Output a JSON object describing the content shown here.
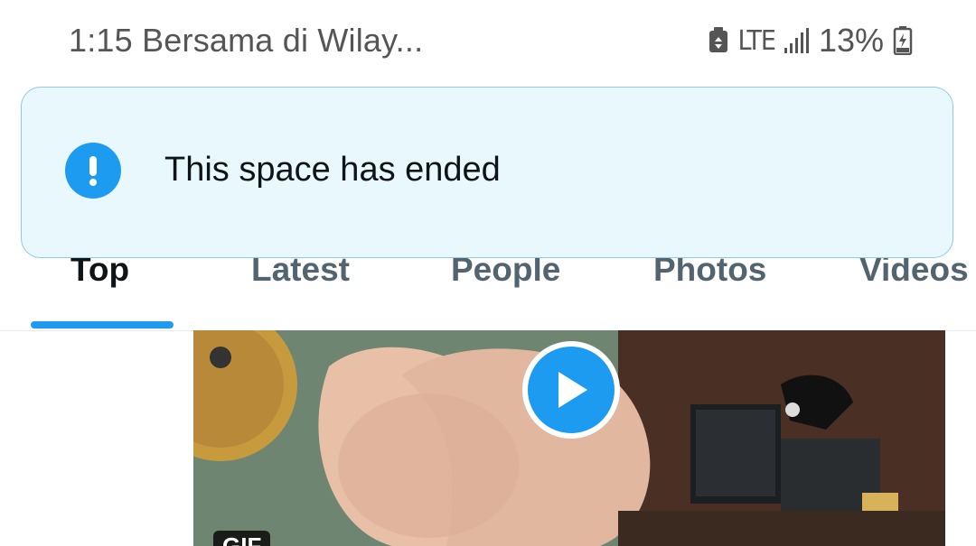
{
  "status_bar": {
    "time_title": "1:15 Bersama di Wilay...",
    "network": "LTE",
    "battery": "13%"
  },
  "toast": {
    "message": "This space has ended",
    "icon": "alert-icon",
    "accent_color": "#1d9bf0"
  },
  "tabs": {
    "items": [
      {
        "label": "Top"
      },
      {
        "label": "Latest"
      },
      {
        "label": "People"
      },
      {
        "label": "Photos"
      },
      {
        "label": "Videos"
      }
    ],
    "active": "Top"
  },
  "media": {
    "badge": "GIF",
    "play_icon": "play-icon"
  }
}
